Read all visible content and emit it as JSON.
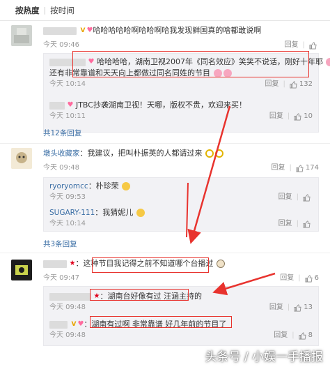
{
  "tabs": {
    "hot": "按热度",
    "time": "按时间"
  },
  "labels": {
    "reply": "回复",
    "arrow_colors": "#e8332e"
  },
  "comments": [
    {
      "text": "哈哈哈哈哈啊哈哈啊哈我发现鲜国真的啥都敢说啊",
      "time": "今天 09:46",
      "likes": "",
      "replies": [
        {
          "name": "",
          "text_a": "哈哈哈哈，湖南卫视2007年《同名效应》笑笑不说话，刚好十年耶",
          "text_b": "还有非常靠谱和天天向上都做过同名同姓的节目",
          "time": "今天 10:14",
          "likes": "132"
        },
        {
          "name": "",
          "text": "JTBC抄袭湖南卫视！天哪，版权不贵，欢迎来买！",
          "time": "今天 10:11",
          "likes": "10"
        }
      ],
      "more": "共12条回复"
    },
    {
      "name": "墩头收藏家",
      "text": "：我建议，把叫朴振英的人都请过来",
      "time": "今天 09:48",
      "likes": "174",
      "replies": [
        {
          "name": "ryoryomcc",
          "text": "：朴珍荣",
          "time": "今天 09:53",
          "likes": ""
        },
        {
          "name": "SUGARY-111",
          "text": "：我猜妮儿",
          "time": "今天 10:14",
          "likes": ""
        }
      ],
      "more": "共3条回复"
    },
    {
      "text": "：这种节目我记得之前不知道哪个台播过",
      "time": "今天 09:47",
      "likes": "6",
      "replies": [
        {
          "name": "",
          "text": "：湖南台好像有过 汪涵主持的",
          "time": "今天 09:48",
          "likes": "13"
        },
        {
          "name": "",
          "text": "：湖南有过啊 非常靠谱 好几年前的节目了",
          "time": "今天 09:48",
          "likes": "8"
        }
      ]
    }
  ],
  "watermark": "头条号 / 小娱一手播报"
}
